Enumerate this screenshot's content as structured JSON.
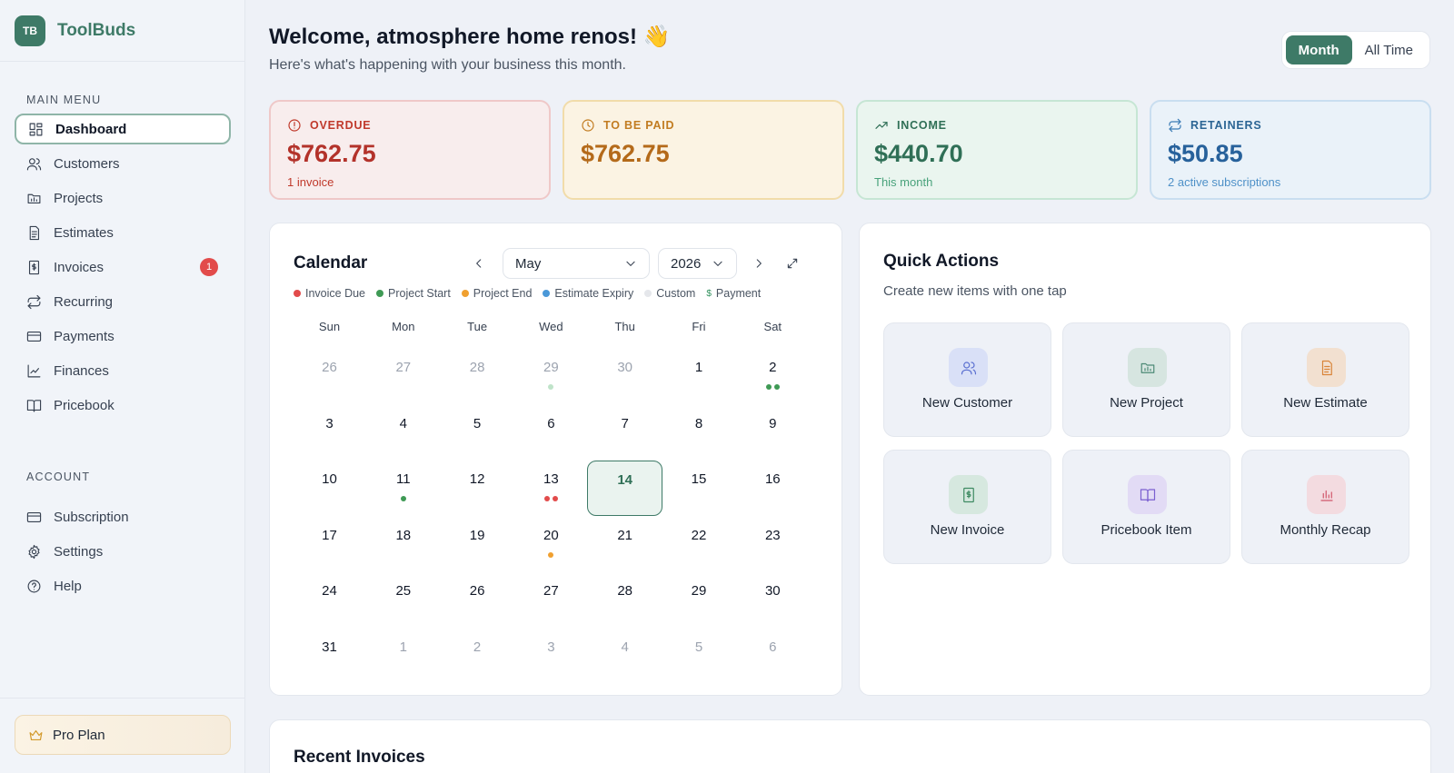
{
  "brand": {
    "logo": "TB",
    "name": "ToolBuds"
  },
  "sidebar": {
    "main_menu_label": "MAIN MENU",
    "items": [
      {
        "label": "Dashboard",
        "icon": "dashboard-icon",
        "active": true
      },
      {
        "label": "Customers",
        "icon": "users-icon"
      },
      {
        "label": "Projects",
        "icon": "folder-icon"
      },
      {
        "label": "Estimates",
        "icon": "document-icon"
      },
      {
        "label": "Invoices",
        "icon": "invoice-icon",
        "badge": "1"
      },
      {
        "label": "Recurring",
        "icon": "repeat-icon"
      },
      {
        "label": "Payments",
        "icon": "card-icon"
      },
      {
        "label": "Finances",
        "icon": "chart-line-icon"
      },
      {
        "label": "Pricebook",
        "icon": "book-icon"
      }
    ],
    "account_label": "ACCOUNT",
    "account_items": [
      {
        "label": "Subscription",
        "icon": "card-icon"
      },
      {
        "label": "Settings",
        "icon": "gear-icon"
      },
      {
        "label": "Help",
        "icon": "help-icon"
      }
    ],
    "pro_plan": "Pro Plan"
  },
  "header": {
    "welcome": "Welcome, atmosphere home renos! 👋",
    "subtitle": "Here's what's happening with your business this month.",
    "toggle": {
      "month": "Month",
      "all_time": "All Time",
      "selected": "Month"
    }
  },
  "stats": {
    "overdue": {
      "label": "OVERDUE",
      "value": "$762.75",
      "sub": "1 invoice",
      "color": "#b3322a"
    },
    "to_be_paid": {
      "label": "TO BE PAID",
      "value": "$762.75",
      "sub": "",
      "color": "#b46a1a"
    },
    "income": {
      "label": "INCOME",
      "value": "$440.70",
      "sub": "This month",
      "color": "#2f6f56"
    },
    "retainers": {
      "label": "RETAINERS",
      "value": "$50.85",
      "sub": "2 active subscriptions",
      "color": "#27619b"
    }
  },
  "calendar": {
    "title": "Calendar",
    "month": "May",
    "year": "2026",
    "legend": [
      {
        "label": "Invoice Due",
        "color": "#e24b4b"
      },
      {
        "label": "Project Start",
        "color": "#3f9a55"
      },
      {
        "label": "Project End",
        "color": "#f0a030"
      },
      {
        "label": "Estimate Expiry",
        "color": "#4a98d8"
      },
      {
        "label": "Custom",
        "color": "#e5e7eb"
      },
      {
        "label": "Payment",
        "color": "#2f8f5b",
        "symbol": "$"
      }
    ],
    "weekdays": [
      "Sun",
      "Mon",
      "Tue",
      "Wed",
      "Thu",
      "Fri",
      "Sat"
    ],
    "weeks": [
      [
        {
          "d": "26",
          "m": true
        },
        {
          "d": "27",
          "m": true
        },
        {
          "d": "28",
          "m": true
        },
        {
          "d": "29",
          "m": true,
          "dots": [
            "#bfe3c9"
          ]
        },
        {
          "d": "30",
          "m": true
        },
        {
          "d": "1"
        },
        {
          "d": "2",
          "dots": [
            "#3f9a55",
            "#3f9a55"
          ]
        }
      ],
      [
        {
          "d": "3"
        },
        {
          "d": "4"
        },
        {
          "d": "5"
        },
        {
          "d": "6"
        },
        {
          "d": "7"
        },
        {
          "d": "8"
        },
        {
          "d": "9"
        }
      ],
      [
        {
          "d": "10"
        },
        {
          "d": "11",
          "dots": [
            "#3f9a55"
          ]
        },
        {
          "d": "12"
        },
        {
          "d": "13",
          "dots": [
            "#e24b4b",
            "#e24b4b"
          ]
        },
        {
          "d": "14",
          "today": true
        },
        {
          "d": "15"
        },
        {
          "d": "16"
        }
      ],
      [
        {
          "d": "17"
        },
        {
          "d": "18"
        },
        {
          "d": "19"
        },
        {
          "d": "20",
          "dots": [
            "#f0a030"
          ]
        },
        {
          "d": "21"
        },
        {
          "d": "22"
        },
        {
          "d": "23"
        }
      ],
      [
        {
          "d": "24"
        },
        {
          "d": "25"
        },
        {
          "d": "26"
        },
        {
          "d": "27"
        },
        {
          "d": "28"
        },
        {
          "d": "29"
        },
        {
          "d": "30"
        }
      ],
      [
        {
          "d": "31"
        },
        {
          "d": "1",
          "m": true
        },
        {
          "d": "2",
          "m": true
        },
        {
          "d": "3",
          "m": true
        },
        {
          "d": "4",
          "m": true
        },
        {
          "d": "5",
          "m": true
        },
        {
          "d": "6",
          "m": true
        }
      ]
    ]
  },
  "quick_actions": {
    "title": "Quick Actions",
    "subtitle": "Create new items with one tap",
    "tiles": [
      {
        "label": "New Customer",
        "icon": "users-icon",
        "bg": "#d9e0f7",
        "stroke": "#5a6fd0"
      },
      {
        "label": "New Project",
        "icon": "folder-icon",
        "bg": "#d6e5e0",
        "stroke": "#4d8a76"
      },
      {
        "label": "New Estimate",
        "icon": "document-icon",
        "bg": "#f2e0d0",
        "stroke": "#d9853a"
      },
      {
        "label": "New Invoice",
        "icon": "invoice-icon",
        "bg": "#d6e8df",
        "stroke": "#3e8a62"
      },
      {
        "label": "Pricebook Item",
        "icon": "book-icon",
        "bg": "#e2dbf5",
        "stroke": "#7b5fd0"
      },
      {
        "label": "Monthly Recap",
        "icon": "bar-chart-icon",
        "bg": "#f3dbe0",
        "stroke": "#d0566b"
      }
    ]
  },
  "recent_invoices": {
    "title": "Recent Invoices"
  }
}
